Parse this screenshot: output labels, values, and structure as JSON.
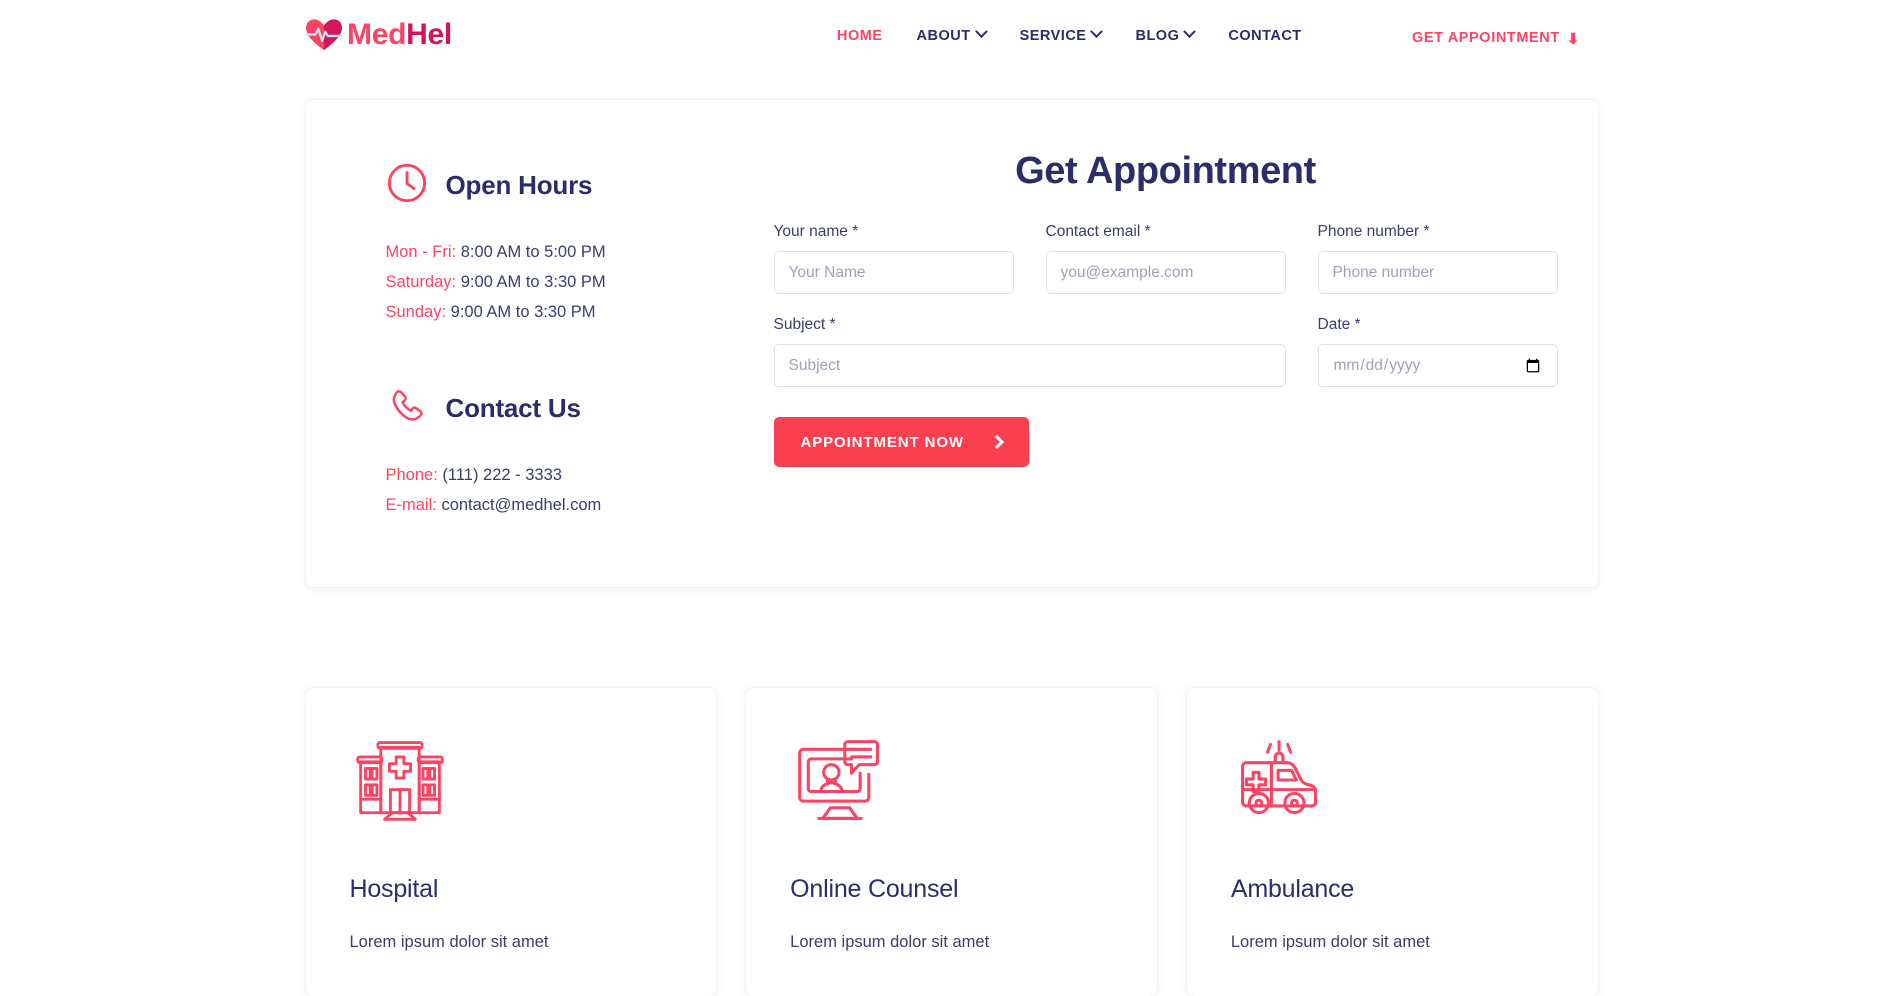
{
  "header": {
    "logo": {
      "icon": "heart-pulse-icon",
      "part1": "Med",
      "part2": "Hel"
    },
    "nav": [
      {
        "label": "HOME",
        "active": true,
        "has_caret": false
      },
      {
        "label": "ABOUT",
        "active": false,
        "has_caret": true
      },
      {
        "label": "SERVICE",
        "active": false,
        "has_caret": true
      },
      {
        "label": "BLOG",
        "active": false,
        "has_caret": true
      },
      {
        "label": "CONTACT",
        "active": false,
        "has_caret": false
      }
    ],
    "cta_label": "GET APPOINTMENT",
    "cta_icon": "arrow-down-icon",
    "accent_color": "#fa4463",
    "nav_color": "#2b2d68"
  },
  "appointment": {
    "open_hours": {
      "icon": "clock-icon",
      "title": "Open Hours",
      "rows": [
        {
          "label": "Mon - Fri:",
          "value": "8:00 AM to 5:00 PM"
        },
        {
          "label": "Saturday:",
          "value": "9:00 AM to 3:30 PM"
        },
        {
          "label": "Sunday:",
          "value": "9:00 AM to 3:30 PM"
        }
      ]
    },
    "contact_us": {
      "icon": "phone-icon",
      "title": "Contact Us",
      "rows": [
        {
          "label": "Phone:",
          "value": "(111) 222 - 3333"
        },
        {
          "label": "E-mail:",
          "value": "contact@medhel.com"
        }
      ]
    },
    "form": {
      "title": "Get Appointment",
      "name": {
        "label": "Your name *",
        "placeholder": "Your Name",
        "value": ""
      },
      "email": {
        "label": "Contact email *",
        "placeholder": "you@example.com",
        "value": ""
      },
      "phone": {
        "label": "Phone number *",
        "placeholder": "Phone number",
        "value": ""
      },
      "subject": {
        "label": "Subject *",
        "placeholder": "Subject",
        "value": ""
      },
      "date": {
        "label": "Date *",
        "placeholder": "mm/dd/yyyy",
        "value": ""
      },
      "submit_label": "APPOINTMENT NOW",
      "submit_icon": "chevron-right-icon",
      "submit_color": "#fa4050"
    }
  },
  "services": [
    {
      "icon": "hospital-building-icon",
      "title": "Hospital",
      "desc": "Lorem ipsum dolor sit amet"
    },
    {
      "icon": "online-counsel-monitor-icon",
      "title": "Online Counsel",
      "desc": "Lorem ipsum dolor sit amet"
    },
    {
      "icon": "ambulance-icon",
      "title": "Ambulance",
      "desc": "Lorem ipsum dolor sit amet"
    }
  ]
}
